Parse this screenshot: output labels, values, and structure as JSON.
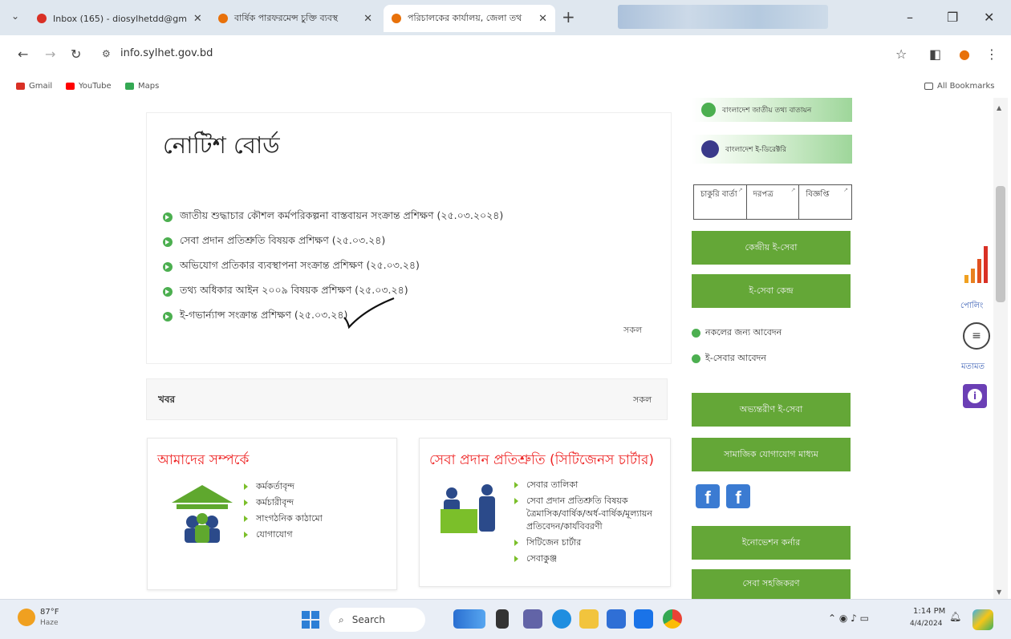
{
  "browser": {
    "tabs": [
      {
        "label": "Inbox (165) - diosylhetdd@gm",
        "favicon_color": "#d93025",
        "active": false
      },
      {
        "label": "বার্ষিক পারফরমেন্স চুক্তি ব্যবস্থ",
        "favicon_color": "#e8710a",
        "active": false
      },
      {
        "label": "পরিচালকের কার্যালয়, জেলা তথ",
        "favicon_color": "#e8710a",
        "active": true
      }
    ],
    "new_tab_label": "+",
    "url": "info.sylhet.gov.bd",
    "bookmarks": [
      {
        "label": "Gmail",
        "color": "#d93025"
      },
      {
        "label": "YouTube",
        "color": "#ff0000"
      },
      {
        "label": "Maps",
        "color": "#34a853"
      }
    ],
    "all_bookmarks_label": "All Bookmarks"
  },
  "notice_board": {
    "title": "নোটিশ বোর্ড",
    "items": [
      "জাতীয় শুদ্ধাচার কৌশল কর্মপরিকল্পনা বাস্তবায়ন সংক্রান্ত প্রশিক্ষণ (২৫.০৩.২০২৪)",
      "সেবা প্রদান প্রতিশ্রুতি বিষয়ক প্রশিক্ষণ (২৫.০৩.২৪)",
      "অভিযোগ প্রতিকার ব্যবস্থাপনা সংক্রান্ত প্রশিক্ষণ (২৫.০৩.২৪)",
      "তথ্য অধিকার আইন ২০০৯ বিষয়ক প্রশিক্ষণ (২৫.০৩.২৪)",
      "ই-গভার্ন্যান্স সংক্রান্ত প্রশিক্ষণ (২৫.০৩.২৪)"
    ],
    "all_label": "সকল"
  },
  "news": {
    "title": "খবর",
    "all_label": "সকল"
  },
  "about": {
    "title": "আমাদের সম্পর্কে",
    "items": [
      "কর্মকর্তাবৃন্দ",
      "কর্মচারীবৃন্দ",
      "সাংগঠনিক কাঠামো",
      "যোগাযোগ"
    ]
  },
  "charter": {
    "title": "সেবা প্রদান প্রতিশ্রুতি (সিটিজেনস চার্টার)",
    "items": [
      "সেবার তালিকা",
      "সেবা প্রদান প্রতিশ্রুতি বিষয়ক ত্রৈমাসিক/বার্ষিক/অর্ধ-বার্ষিক/মূল্যায়ন প্রতিবেদন/কার্যবিবরণী",
      "সিটিজেন চার্টার",
      "সেবাকুঞ্জ"
    ]
  },
  "sidebar": {
    "banners": [
      {
        "label": "বাংলাদেশ জাতীয় তথ্য বাতায়ন",
        "color": "#4caf50"
      },
      {
        "label": "বাংলাদেশ ই-ডিরেক্টরি",
        "color": "#3a3a8a"
      }
    ],
    "tabs": [
      "চাকুরি বার্তা",
      "দরপত্র",
      "বিজ্ঞপ্তি"
    ],
    "buttons_top": [
      "কেন্দ্রীয় ই-সেবা",
      "ই-সেবা কেন্দ্র"
    ],
    "links": [
      "নকলের জন্য আবেদন",
      "ই-সেবার আবেদন"
    ],
    "buttons_bottom": [
      "অভ্যন্তরীণ ই-সেবা",
      "সামাজিক যোগাযোগ মাধ্যম"
    ],
    "buttons_end": [
      "ইনোভেশন কর্নার",
      "সেবা সহজিকরণ"
    ]
  },
  "floating": {
    "poll_label": "পোলিং",
    "feedback_label": "মতামত"
  },
  "taskbar": {
    "temperature": "87°F",
    "weather": "Haze",
    "search_placeholder": "Search",
    "time": "1:14 PM",
    "date": "4/4/2024"
  }
}
